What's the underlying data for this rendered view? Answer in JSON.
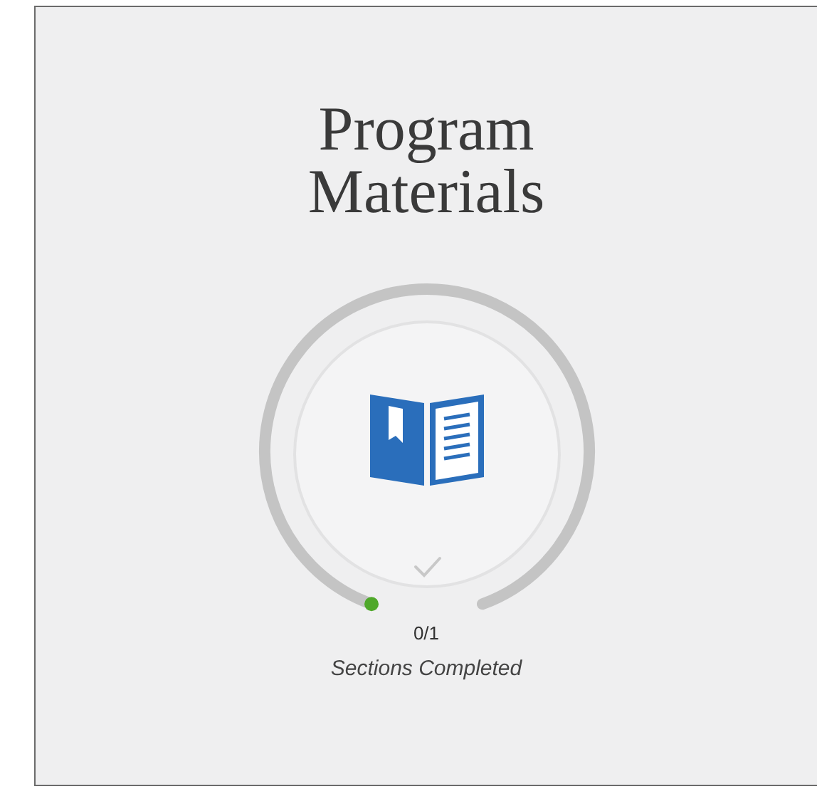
{
  "card": {
    "title": "Program Materials",
    "progress": {
      "count": "0/1",
      "label": "Sections Completed",
      "completed": false
    }
  }
}
